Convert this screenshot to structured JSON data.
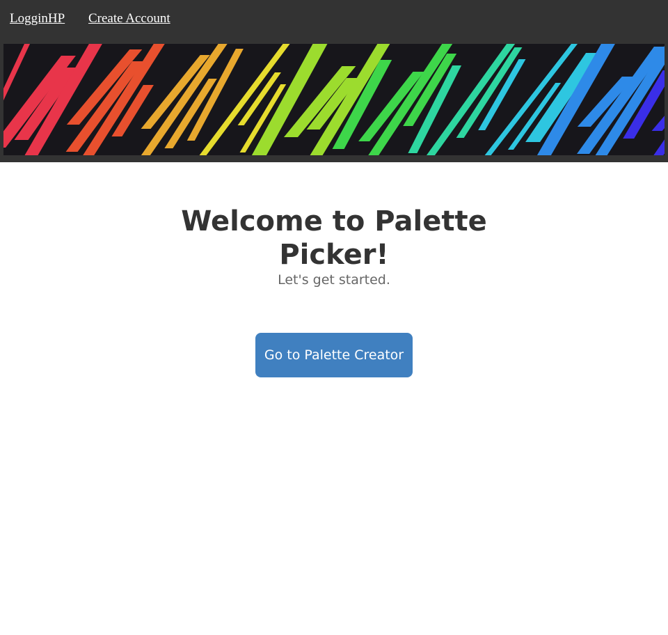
{
  "nav": {
    "links": [
      {
        "label": "LogginHP"
      },
      {
        "label": "Create Account"
      }
    ]
  },
  "banner": {
    "description_icon": "rainbow-stripes-banner",
    "colors": [
      "#e8354a",
      "#e8502e",
      "#e8a82e",
      "#e6dc2e",
      "#9cdc2e",
      "#3ed64a",
      "#2ed6a0",
      "#2ec6e0",
      "#2e8ae8",
      "#3a2ee8"
    ]
  },
  "hero": {
    "title": "Welcome to Palette Picker!",
    "subtitle": "Let's get started."
  },
  "cta": {
    "label": "Go to Palette Creator"
  },
  "colors": {
    "header_bg": "#333333",
    "button_bg": "#4080c0",
    "title_color": "#333333",
    "subtitle_color": "#666666"
  }
}
